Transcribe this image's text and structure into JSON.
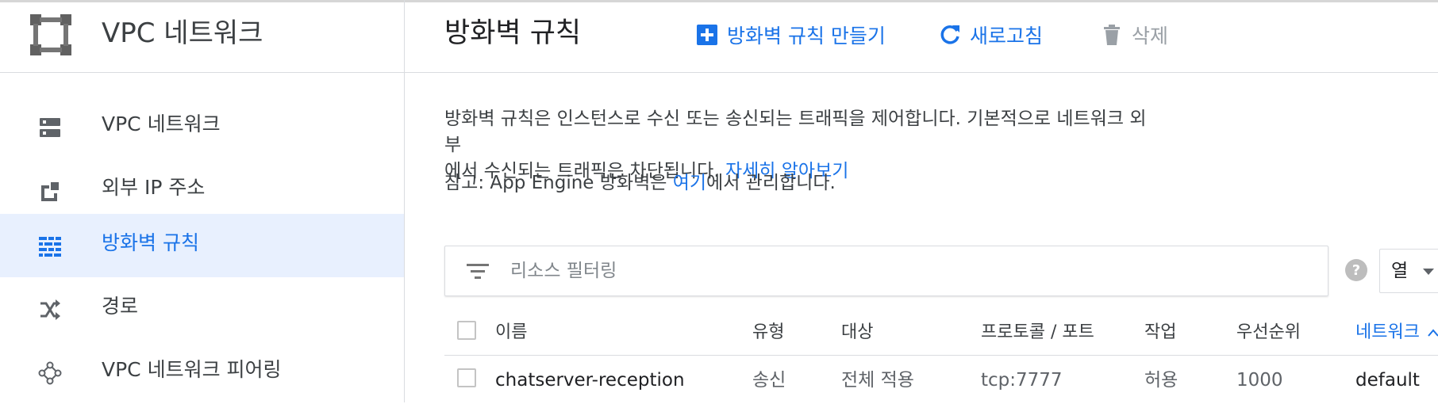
{
  "sidebar": {
    "title": "VPC 네트워크",
    "items": [
      {
        "label": "VPC 네트워크",
        "icon": "vpc-network-icon"
      },
      {
        "label": "외부 IP 주소",
        "icon": "external-ip-icon"
      },
      {
        "label": "방화벽 규칙",
        "icon": "firewall-icon",
        "active": true
      },
      {
        "label": "경로",
        "icon": "routes-icon"
      },
      {
        "label": "VPC 네트워크 피어링",
        "icon": "peering-icon"
      }
    ]
  },
  "header": {
    "title": "방화벽 규칙",
    "create_label": "방화벽 규칙 만들기",
    "refresh_label": "새로고침",
    "delete_label": "삭제"
  },
  "main": {
    "description_1": "방화벽 규칙은 인스턴스로 수신 또는 송신되는 트래픽을 제어합니다. 기본적으로 네트워크 외부",
    "description_2": "에서 수신되는 트래픽은 차단됩니다.",
    "learn_more": "자세히 알아보기",
    "note_prefix": "참고: App Engine 방화벽은 ",
    "note_link": "여기",
    "note_suffix": "에서 관리합니다.",
    "filter_placeholder": "리소스 필터링",
    "columns_label": "열"
  },
  "table": {
    "headers": {
      "name": "이름",
      "type": "유형",
      "target": "대상",
      "protocol": "프로토콜 / 포트",
      "action": "작업",
      "priority": "우선순위",
      "network": "네트워크"
    },
    "rows": [
      {
        "name": "chatserver-reception",
        "type": "송신",
        "target": "전체 적용",
        "protocol": "tcp:7777",
        "action": "허용",
        "priority": "1000",
        "network": "default"
      }
    ]
  },
  "colors": {
    "accent": "#1a73e8",
    "active_bg": "#e8f0fe",
    "border": "#dadce0",
    "disabled": "#9aa0a6"
  }
}
